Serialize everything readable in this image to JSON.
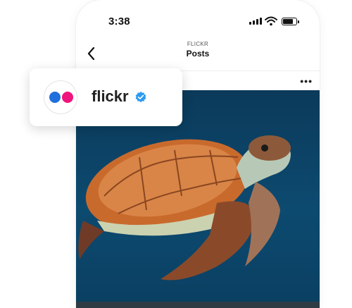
{
  "status_bar": {
    "time": "3:38"
  },
  "nav": {
    "subtitle": "FLICKR",
    "title": "Posts"
  },
  "profile_card": {
    "name": "flickr",
    "verified": true
  },
  "colors": {
    "flickr_blue": "#1f6fdd",
    "flickr_pink": "#f0147d",
    "verified_blue": "#2d9bf0",
    "ocean": "#0d4a70"
  },
  "icons": [
    "back-chevron-icon",
    "more-icon",
    "verified-badge-icon",
    "signal-icon",
    "wifi-icon",
    "battery-icon"
  ]
}
